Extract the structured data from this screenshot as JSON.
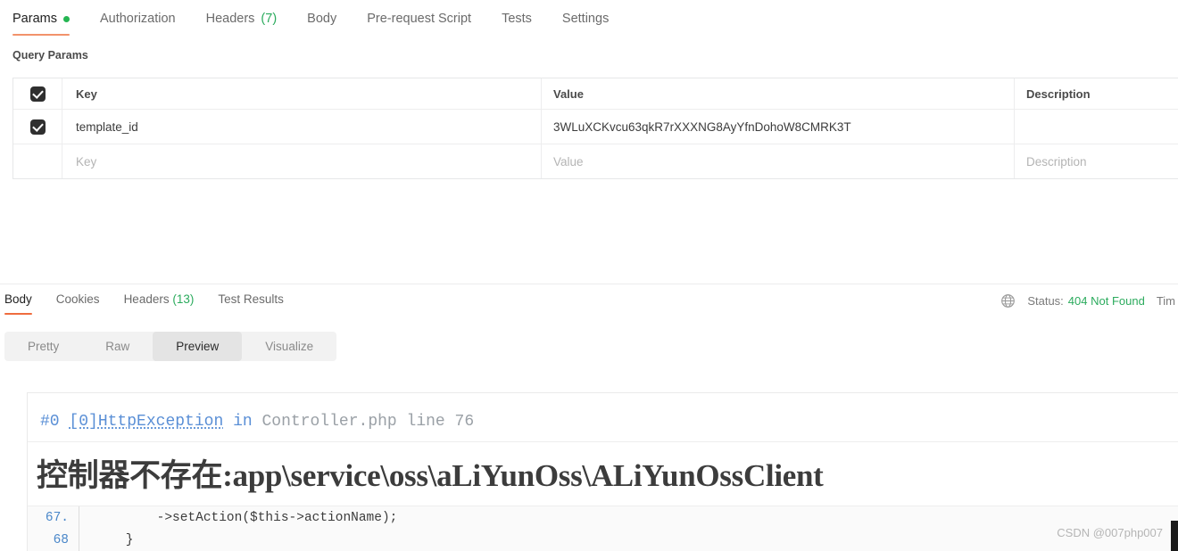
{
  "request": {
    "tabs": [
      {
        "label": "Params",
        "active": true,
        "dot": true
      },
      {
        "label": "Authorization",
        "active": false
      },
      {
        "label": "Headers",
        "count": "(7)",
        "active": false
      },
      {
        "label": "Body",
        "active": false
      },
      {
        "label": "Pre-request Script",
        "active": false
      },
      {
        "label": "Tests",
        "active": false
      },
      {
        "label": "Settings",
        "active": false
      }
    ],
    "section_label": "Query Params",
    "table": {
      "headers": {
        "key": "Key",
        "value": "Value",
        "description": "Description"
      },
      "rows": [
        {
          "checked": true,
          "key": "template_id",
          "value": "3WLuXCKvcu63qkR7rXXXNG8AyYfnDohoW8CMRK3T",
          "description": ""
        }
      ],
      "empty_row": {
        "key": "Key",
        "value": "Value",
        "description": "Description"
      }
    }
  },
  "response": {
    "tabs": [
      {
        "label": "Body",
        "active": true
      },
      {
        "label": "Cookies",
        "active": false
      },
      {
        "label": "Headers",
        "count": "(13)",
        "active": false
      },
      {
        "label": "Test Results",
        "active": false
      }
    ],
    "status": {
      "icon": "globe-icon",
      "label": "Status:",
      "code": "404 Not Found",
      "time_label": "Tim"
    },
    "view_modes": [
      {
        "label": "Pretty",
        "active": false
      },
      {
        "label": "Raw",
        "active": false
      },
      {
        "label": "Preview",
        "active": true
      },
      {
        "label": "Visualize",
        "active": false
      }
    ],
    "preview": {
      "error_frame": "#0",
      "error_index": "[0]",
      "exception": "HttpException",
      "in_word": "in",
      "file_line": "Controller.php line 76",
      "title": "控制器不存在:app\\service\\oss\\aLiYunOss\\ALiYunOssClient",
      "code_lines": [
        {
          "number": "67.",
          "text": "        ->setAction($this->actionName);"
        },
        {
          "number": "68",
          "text": "    }"
        }
      ]
    }
  },
  "watermark": "CSDN @007php007",
  "colors": {
    "accent_orange": "#ef6c3e",
    "params_underline": "#f2926b",
    "green": "#2bab5d",
    "dot_green": "#25b552",
    "link_blue": "#5a8fd6",
    "line_number_blue": "#4a87c9"
  }
}
